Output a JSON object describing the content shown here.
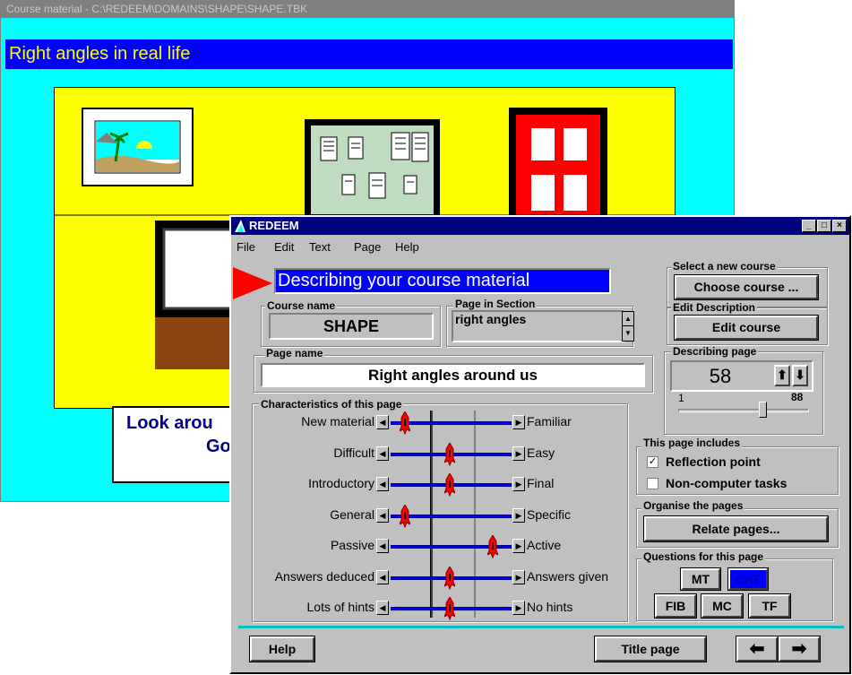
{
  "back_window": {
    "title": "Course material - C:\\REDEEM\\DOMAINS\\SHAPE\\SHAPE.TBK",
    "header": "Right angles in real life",
    "caption_line1": "Look arou",
    "caption_line2": "Go"
  },
  "front_window": {
    "title": "REDEEM",
    "menu": [
      "File",
      "Edit",
      "Text",
      "Page",
      "Help"
    ],
    "heading": "Describing your course material",
    "course_name_label": "Course name",
    "course_name": "SHAPE",
    "page_in_section_label": "Page in Section",
    "page_in_section": "right angles",
    "page_name_label": "Page name",
    "page_name": "Right angles around us",
    "characteristics_label": "Characteristics of this page",
    "characteristics": [
      {
        "left": "New material",
        "right": "Familiar",
        "value": 1
      },
      {
        "left": "Difficult",
        "right": "Easy",
        "value": 2
      },
      {
        "left": "Introductory",
        "right": "Final",
        "value": 2
      },
      {
        "left": "General",
        "right": "Specific",
        "value": 1
      },
      {
        "left": "Passive",
        "right": "Active",
        "value": 3
      },
      {
        "left": "Answers deduced",
        "right": "Answers given",
        "value": 2
      },
      {
        "left": "Lots of hints",
        "right": "No hints",
        "value": 2
      }
    ],
    "select_course_label": "Select a new course",
    "choose_course": "Choose course ...",
    "edit_description_label": "Edit Description",
    "edit_course": "Edit course",
    "describing_page_label": "Describing page",
    "page_number": "58",
    "range_min": "1",
    "range_max": "88",
    "includes_label": "This page includes",
    "reflection_point": "Reflection point",
    "reflection_checked": "✓",
    "non_computer": "Non-computer tasks",
    "organise_label": "Organise the pages",
    "relate_pages": "Relate pages...",
    "questions_label": "Questions for this page",
    "q_mt": "MT",
    "q_cat": "CAT",
    "q_fib": "FIB",
    "q_mc": "MC",
    "q_tf": "TF",
    "help": "Help",
    "title_page": "Title page",
    "colors": {
      "title_bar": "#000080",
      "accent_blue": "#0000ff",
      "window": "#c0c0c0",
      "highlight": "#0000ff"
    }
  }
}
